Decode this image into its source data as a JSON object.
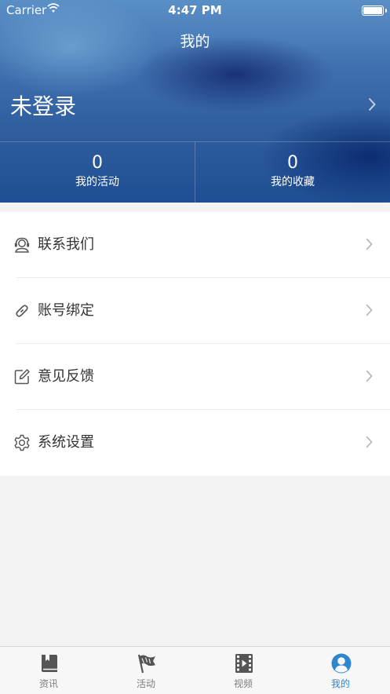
{
  "status_bar": {
    "carrier": "Carrier",
    "time": "4:47 PM"
  },
  "header": {
    "title": "我的",
    "login_text": "未登录",
    "stats": [
      {
        "value": "0",
        "label": "我的活动"
      },
      {
        "value": "0",
        "label": "我的收藏"
      }
    ]
  },
  "menu": {
    "items": [
      {
        "label": "联系我们",
        "icon": "headset-icon"
      },
      {
        "label": "账号绑定",
        "icon": "link-icon"
      },
      {
        "label": "意见反馈",
        "icon": "edit-icon"
      },
      {
        "label": "系统设置",
        "icon": "gear-icon"
      }
    ]
  },
  "tabbar": {
    "tabs": [
      {
        "label": "资讯",
        "icon": "book-icon",
        "active": false
      },
      {
        "label": "活动",
        "icon": "flag-icon",
        "active": false
      },
      {
        "label": "视频",
        "icon": "film-icon",
        "active": false
      },
      {
        "label": "我的",
        "icon": "user-icon",
        "active": true
      }
    ],
    "active_color": "#2e86cf",
    "inactive_color": "#555555"
  }
}
